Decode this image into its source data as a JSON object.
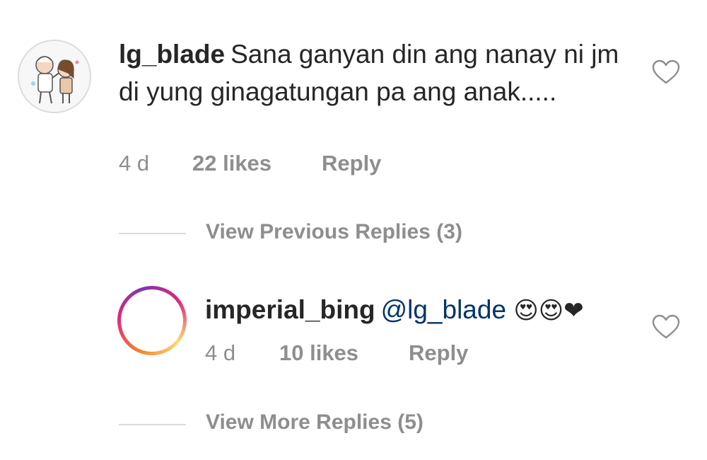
{
  "comments": [
    {
      "username": "lg_blade",
      "text": "Sana ganyan din ang nanay ni jm di yung ginagatungan pa ang anak.....",
      "time": "4 d",
      "likes": "22 likes",
      "reply": "Reply"
    },
    {
      "username": "imperial_bing",
      "mention": "@lg_blade",
      "emojis": "😍😍❤",
      "time": "4 d",
      "likes": "10 likes",
      "reply": "Reply"
    }
  ],
  "thread": {
    "view_previous": "View Previous Replies (3)",
    "view_more": "View More Replies (5)"
  },
  "icons": {
    "like": "heart-outline-icon"
  },
  "colors": {
    "text": "#262626",
    "meta": "#8e8e8e",
    "mention": "#003569",
    "divider": "#dbdbdb"
  }
}
